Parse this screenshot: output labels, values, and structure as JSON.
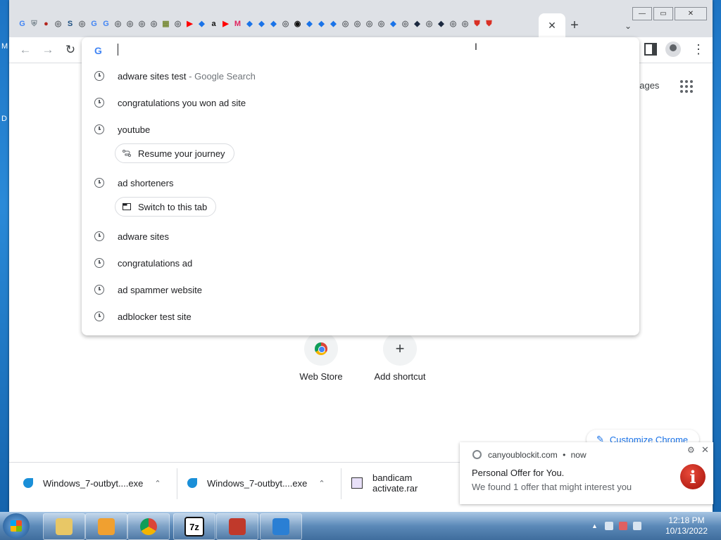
{
  "desktop": {
    "edge_text_top": "M",
    "edge_text_mid": "D"
  },
  "browser": {
    "tab_favicons": [
      {
        "glyph": "G",
        "color": "#4285f4"
      },
      {
        "glyph": "⛨",
        "color": "#7a8790"
      },
      {
        "glyph": "●",
        "color": "#b3261e"
      },
      {
        "glyph": "◎",
        "color": "#5f6368"
      },
      {
        "glyph": "S",
        "color": "#1c4e80"
      },
      {
        "glyph": "◎",
        "color": "#5f6368"
      },
      {
        "glyph": "G",
        "color": "#4285f4"
      },
      {
        "glyph": "G",
        "color": "#4285f4"
      },
      {
        "glyph": "◎",
        "color": "#5f6368"
      },
      {
        "glyph": "◎",
        "color": "#5f6368"
      },
      {
        "glyph": "◎",
        "color": "#5f6368"
      },
      {
        "glyph": "◎",
        "color": "#5f6368"
      },
      {
        "glyph": "▦",
        "color": "#7a8c3a"
      },
      {
        "glyph": "◎",
        "color": "#5f6368"
      },
      {
        "glyph": "▶",
        "color": "#ff0000"
      },
      {
        "glyph": "◆",
        "color": "#1a73e8"
      },
      {
        "glyph": "a",
        "color": "#111111"
      },
      {
        "glyph": "▶",
        "color": "#ff0000"
      },
      {
        "glyph": "M",
        "color": "#e0245e"
      },
      {
        "glyph": "◆",
        "color": "#1a73e8"
      },
      {
        "glyph": "◆",
        "color": "#1a73e8"
      },
      {
        "glyph": "◆",
        "color": "#1a73e8"
      },
      {
        "glyph": "◎",
        "color": "#5f6368"
      },
      {
        "glyph": "◉",
        "color": "#111111"
      },
      {
        "glyph": "◆",
        "color": "#1a73e8"
      },
      {
        "glyph": "◆",
        "color": "#1a73e8"
      },
      {
        "glyph": "◆",
        "color": "#1a73e8"
      },
      {
        "glyph": "◎",
        "color": "#5f6368"
      },
      {
        "glyph": "◎",
        "color": "#5f6368"
      },
      {
        "glyph": "◎",
        "color": "#5f6368"
      },
      {
        "glyph": "◎",
        "color": "#5f6368"
      },
      {
        "glyph": "◆",
        "color": "#1a73e8"
      },
      {
        "glyph": "◎",
        "color": "#5f6368"
      },
      {
        "glyph": "◆",
        "color": "#1c2a40"
      },
      {
        "glyph": "◎",
        "color": "#5f6368"
      },
      {
        "glyph": "◆",
        "color": "#1c2a40"
      },
      {
        "glyph": "◎",
        "color": "#5f6368"
      },
      {
        "glyph": "◎",
        "color": "#5f6368"
      },
      {
        "glyph": "⛊",
        "color": "#d93025"
      },
      {
        "glyph": "⛊",
        "color": "#d93025"
      }
    ],
    "active_tab_close": "✕",
    "new_tab": "+",
    "tab_search": "⌄",
    "window_controls": {
      "minimize": "—",
      "maximize": "▭",
      "close": "✕"
    },
    "nav": {
      "back": "←",
      "forward": "→",
      "reload": "↻"
    },
    "menu": "⋮"
  },
  "omnibox": {
    "logo": "G",
    "value": "",
    "suggestions": [
      {
        "text": "adware sites test",
        "sub": " - Google Search"
      },
      {
        "text": "congratulations you won ad site",
        "sub": ""
      },
      {
        "text": "youtube",
        "sub": ""
      },
      {
        "text": "ad shorteners",
        "sub": ""
      },
      {
        "text": "adware sites",
        "sub": ""
      },
      {
        "text": "congratulations ad",
        "sub": ""
      },
      {
        "text": "ad spammer website",
        "sub": ""
      },
      {
        "text": "adblocker test site",
        "sub": ""
      }
    ],
    "chips": {
      "resume": "Resume your journey",
      "switch_tab": "Switch to this tab"
    }
  },
  "ntp": {
    "images_link": "nages",
    "shortcuts": [
      {
        "label": "Web Store"
      },
      {
        "label": "Add shortcut",
        "glyph": "+"
      }
    ],
    "customize": "Customize Chrome"
  },
  "downloads": [
    {
      "name": "Windows_7-outbyt....exe",
      "chevron": "⌃"
    },
    {
      "name": "Windows_7-outbyt....exe",
      "chevron": "⌃"
    },
    {
      "name": "bandicam activate.rar",
      "chevron": ""
    }
  ],
  "notification": {
    "source": "canyoublockit.com",
    "dot": "•",
    "time": "now",
    "title": "Personal Offer for You.",
    "body": "We found 1 offer that might interest you",
    "gear": "⚙",
    "close": "✕",
    "icon": "i"
  },
  "taskbar": {
    "apps": [
      {
        "name": "explorer",
        "color": "#e8c766"
      },
      {
        "name": "media-player",
        "color": "#f0a030"
      },
      {
        "name": "chrome",
        "color": "#db4437"
      },
      {
        "name": "7zip",
        "color": "#111111",
        "label": "7z"
      },
      {
        "name": "installer",
        "color": "#c0392b"
      },
      {
        "name": "outbyte",
        "color": "#2a7fd4"
      }
    ],
    "tray_arrow": "▲",
    "time": "12:18 PM",
    "date": "10/13/2022"
  },
  "cursor": "I"
}
